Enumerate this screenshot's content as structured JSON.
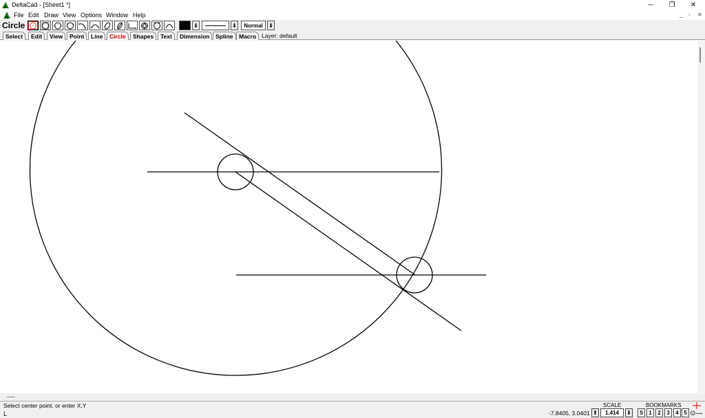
{
  "window": {
    "title": "DeltaCad - [Sheet1 *]",
    "minimize": "─",
    "restore": "❐",
    "close": "✕"
  },
  "menu": {
    "items": [
      "File",
      "Edit",
      "Draw",
      "View",
      "Options",
      "Window",
      "Help"
    ],
    "mdi": [
      "_",
      "▫",
      "✕"
    ]
  },
  "toolbar": {
    "title": "Circle",
    "dropdown_arrow": "⬇",
    "line_style_preview": "solid",
    "mode_value": "Normal",
    "current_color": "#000000"
  },
  "tabs": {
    "items": [
      "Select",
      "Edit",
      "View",
      "Point",
      "Line",
      "Circle",
      "Shapes",
      "Text",
      "Dimension",
      "Spline",
      "Macro"
    ],
    "active": "Circle",
    "layer": "Layer: default"
  },
  "status": {
    "prompt": "Select center point, or enter X,Y",
    "cursor": "L",
    "coordinates": "-7.8405, 3.0401",
    "scale_label": "SCALE",
    "scale_up": "⬆",
    "scale_value": "1.414",
    "scale_down": "⬇",
    "bookmarks_label": "BOOKMARKS",
    "bookmarks": [
      "S",
      "1",
      "2",
      "3",
      "4",
      "5"
    ],
    "target_symbol": "⊙—"
  },
  "colors": {
    "active_tab": "#e00000",
    "drawing": "#000000",
    "crosshair": "#e00000"
  }
}
